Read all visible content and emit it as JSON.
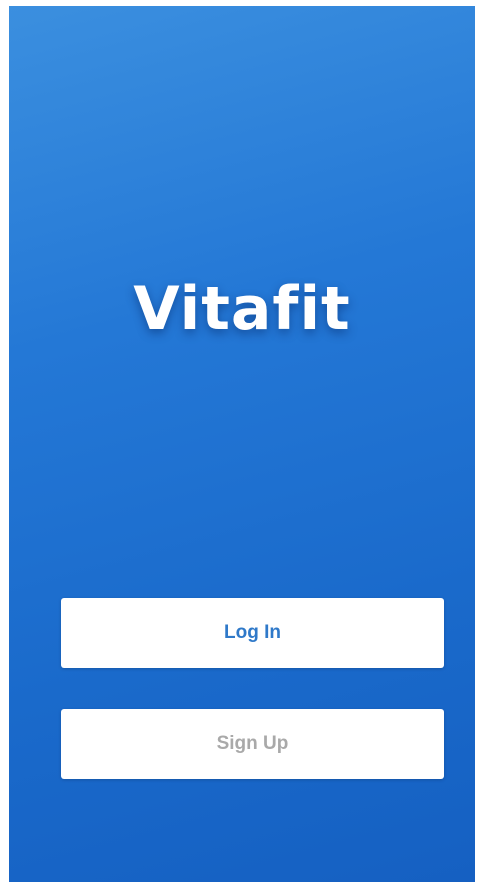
{
  "app": {
    "title": "Vitafit"
  },
  "actions": {
    "login_label": "Log In",
    "signup_label": "Sign Up"
  },
  "colors": {
    "background_accent": "#2478d6",
    "login_text": "#2f79c9",
    "signup_text": "#a9a9a9",
    "button_bg": "#ffffff"
  }
}
